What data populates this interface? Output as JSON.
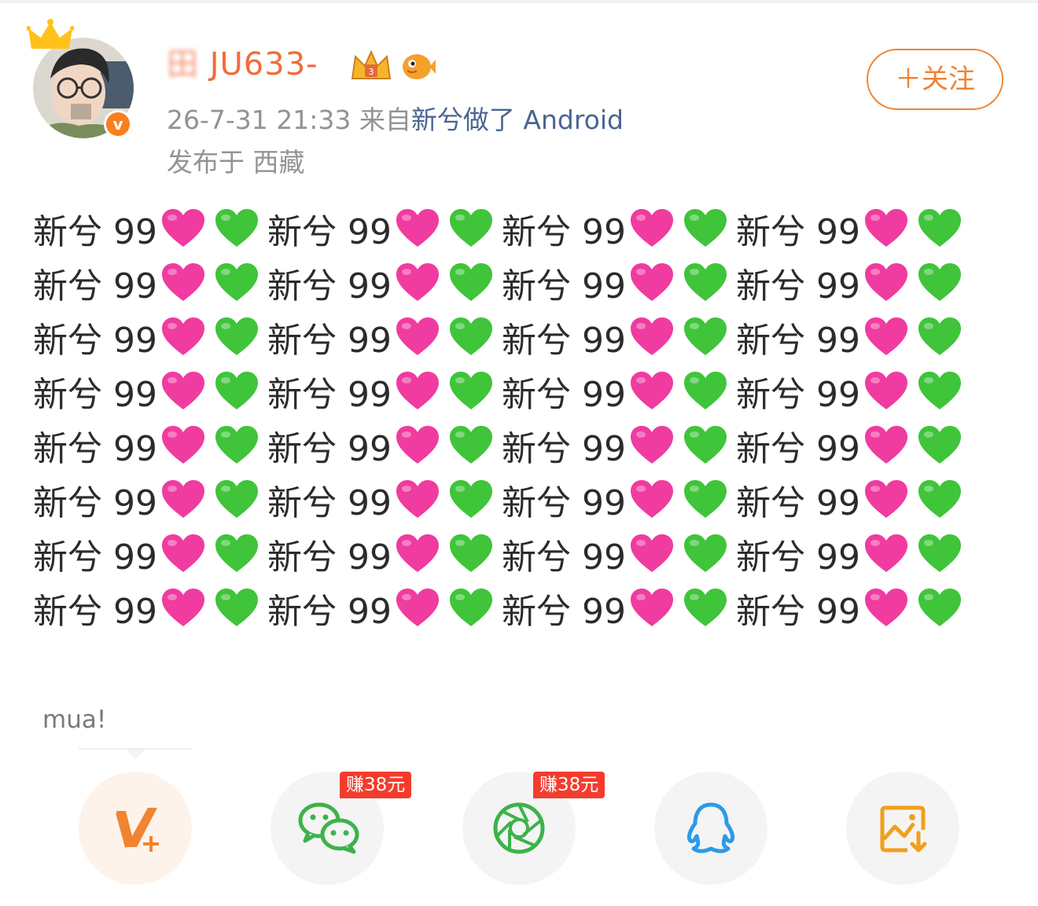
{
  "post": {
    "username": "JU633-",
    "username_blurred_prefix": "田",
    "timestamp": "26-7-31 21:33",
    "source_prefix": "来自",
    "source_name": "新兮做了 Android",
    "location": "发布于 西藏",
    "follow_label": "＋关注",
    "content_rows": 8,
    "content_per_row": 4,
    "content_unit_text": "新兮 99",
    "colors": {
      "accent": "#f08431",
      "username": "#f26b3a",
      "link": "#4a6593",
      "heart_pink": "#f03ba0",
      "heart_green": "#3fc43a"
    }
  },
  "popup": {
    "text": "mua!"
  },
  "share": {
    "items": [
      {
        "name": "weibo-v-plus-icon",
        "badge": ""
      },
      {
        "name": "wechat-icon",
        "badge": "赚38元"
      },
      {
        "name": "moments-icon",
        "badge": "赚38元"
      },
      {
        "name": "qq-icon",
        "badge": ""
      },
      {
        "name": "save-image-icon",
        "badge": ""
      }
    ]
  }
}
